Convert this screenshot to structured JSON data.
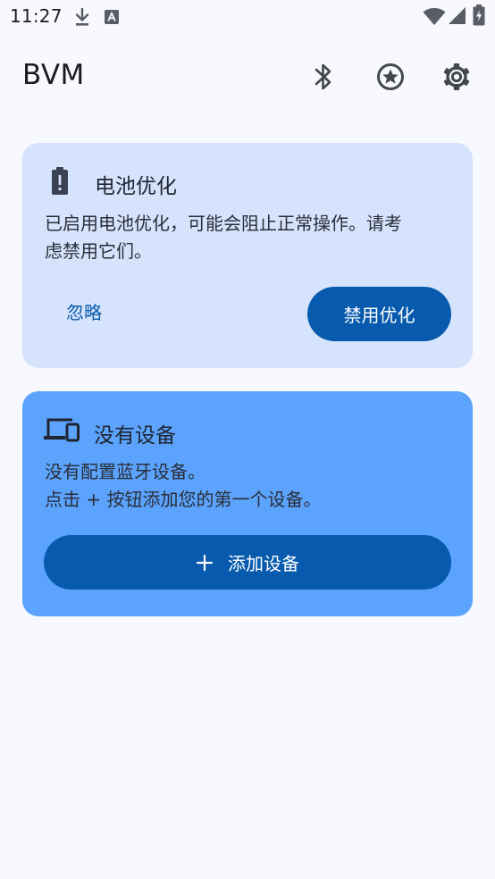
{
  "status_bar": {
    "time": "11:27",
    "icons": [
      "download-icon",
      "keyboard-a-icon",
      "wifi-icon",
      "signal-icon",
      "battery-charging-icon"
    ]
  },
  "app_bar": {
    "title": "BVM",
    "actions": [
      "bluetooth-icon",
      "star-badge-icon",
      "settings-icon"
    ]
  },
  "battery_card": {
    "title": "电池优化",
    "body_line1": "已启用电池优化，可能会阻止正常操作。请考",
    "body_line2": "虑禁用它们。",
    "ignore_label": "忽略",
    "disable_label": "禁用优化"
  },
  "devices_card": {
    "title": "没有设备",
    "body_line1": "没有配置蓝牙设备。",
    "body_line2": "点击 + 按钮添加您的第一个设备。",
    "add_label": "添加设备"
  },
  "colors": {
    "background": "#f8f8ff",
    "battery_card": "#d6e3fc",
    "devices_card": "#5ba3fc",
    "primary_button": "#075aad",
    "text_link": "#0b5cab"
  }
}
